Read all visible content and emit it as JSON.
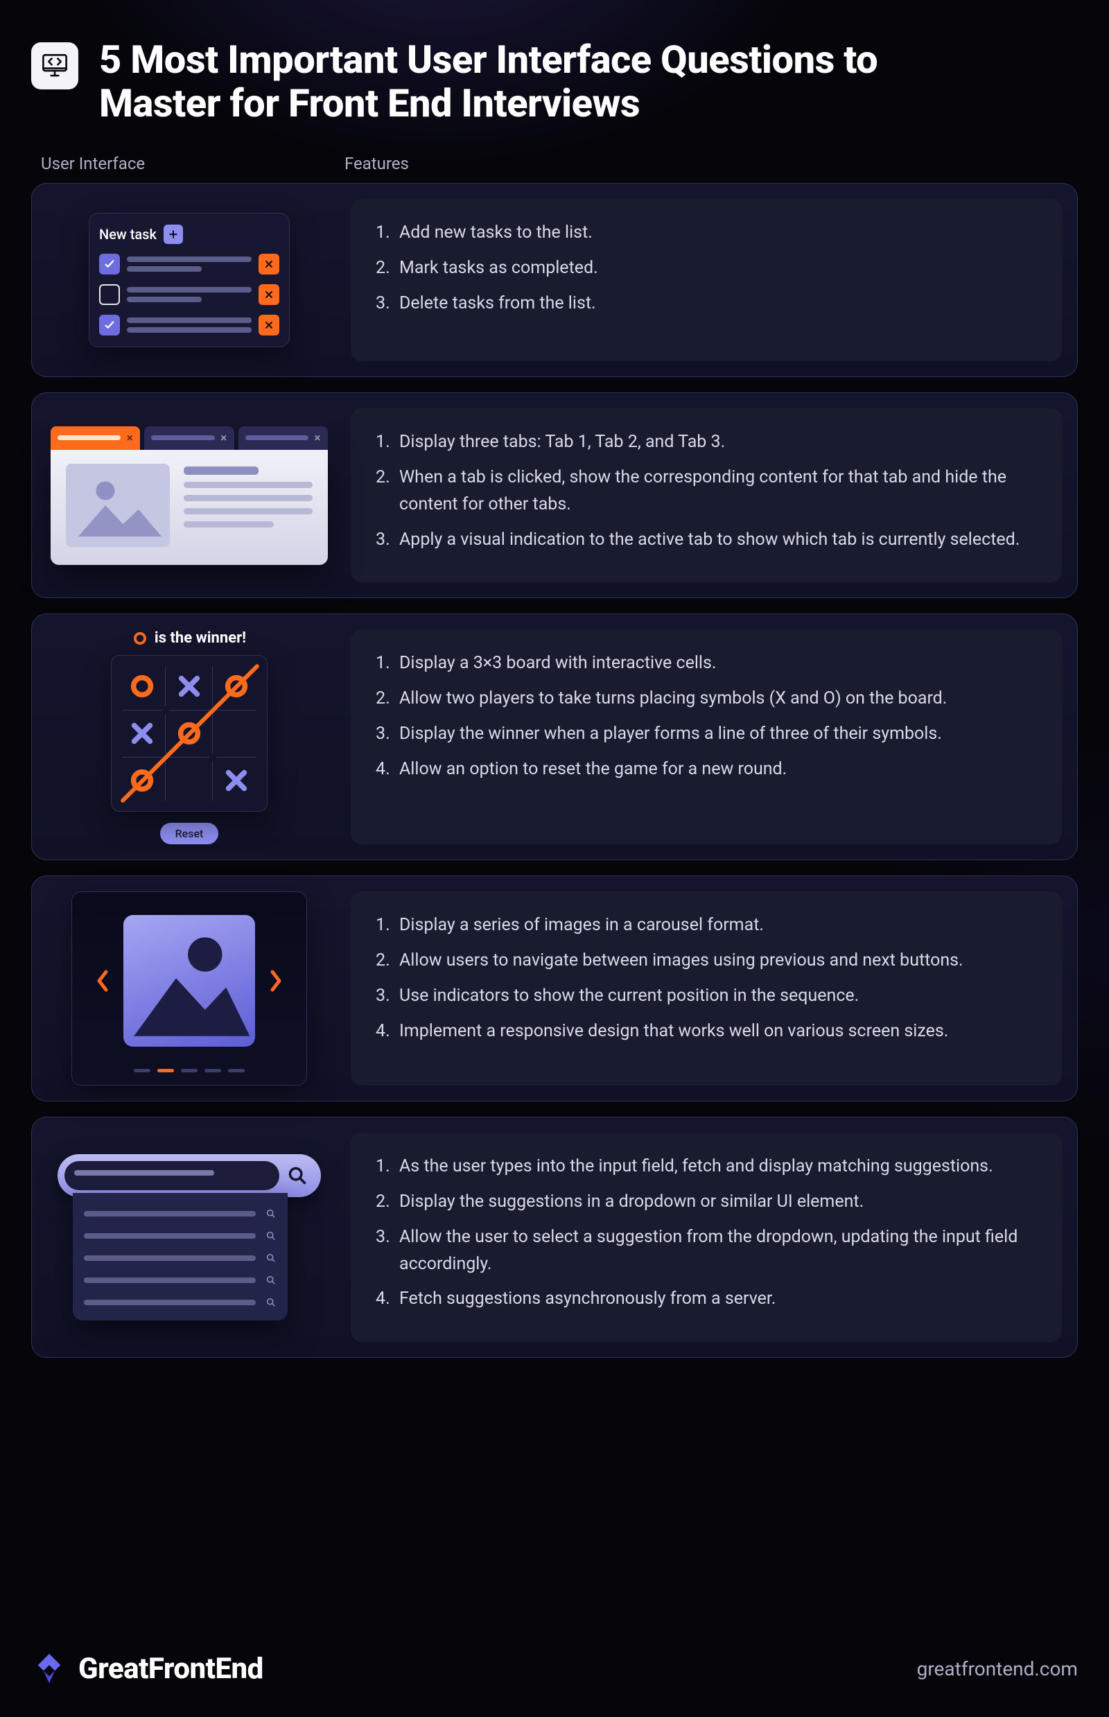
{
  "header": {
    "title": "5 Most Important User Interface Questions to Master for Front End Interviews"
  },
  "columns": {
    "ui": "User Interface",
    "features": "Features"
  },
  "rows": [
    {
      "id": "todo",
      "illus": {
        "newTaskLabel": "New task"
      },
      "features": [
        "Add new tasks to the list.",
        "Mark tasks as completed.",
        "Delete tasks from the list."
      ]
    },
    {
      "id": "tabs",
      "features": [
        "Display three tabs: Tab 1, Tab 2, and Tab 3.",
        "When a tab is clicked, show the corresponding content for that tab and hide the content for other tabs.",
        "Apply a visual indication to the active tab to show which tab is currently selected."
      ]
    },
    {
      "id": "tictactoe",
      "illus": {
        "winnerText": "is the winner!",
        "resetLabel": "Reset"
      },
      "features": [
        "Display a 3×3 board with interactive cells.",
        "Allow two players to take turns placing symbols (X and O) on the board.",
        "Display the winner when a player forms a line of three of their symbols.",
        "Allow an option to reset the game for a new round."
      ]
    },
    {
      "id": "carousel",
      "features": [
        "Display a series of images in a carousel format.",
        "Allow users to navigate between images using previous and next buttons.",
        "Use indicators to show the current position in the sequence.",
        "Implement a responsive design that works well on various screen sizes."
      ]
    },
    {
      "id": "autocomplete",
      "features": [
        "As the user types into the input field, fetch and display matching suggestions.",
        "Display the suggestions in a dropdown or similar UI element.",
        "Allow the user to select a suggestion from the dropdown, updating the input field accordingly.",
        "Fetch suggestions asynchronously from a server."
      ]
    }
  ],
  "footer": {
    "brand": "GreatFrontEnd",
    "url": "greatfrontend.com"
  }
}
